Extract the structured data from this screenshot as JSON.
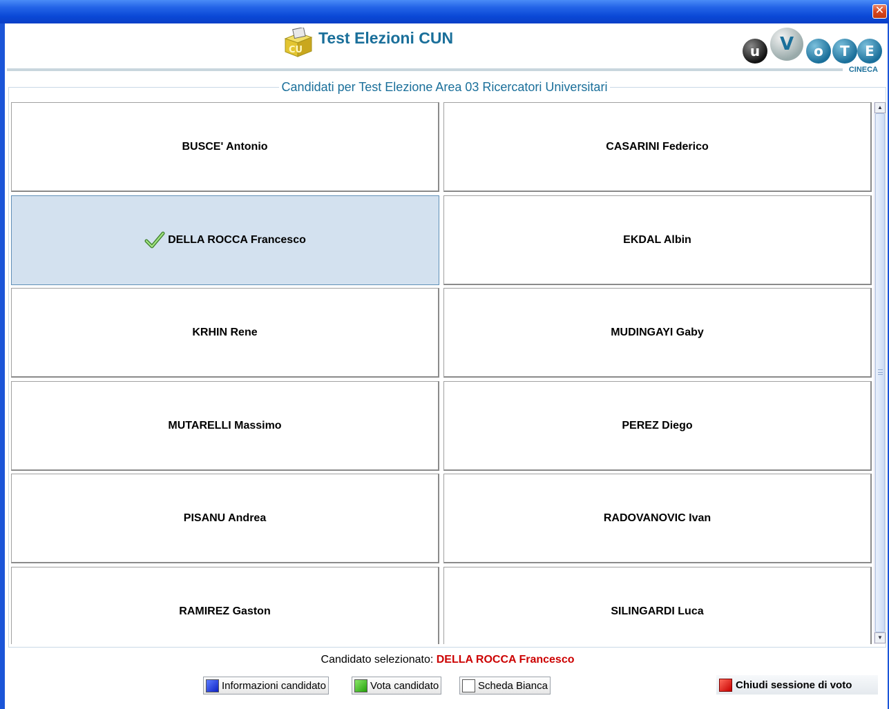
{
  "window": {
    "close_glyph": "✕"
  },
  "header": {
    "title": "Test Elezioni CUN",
    "brand_letters": [
      "u",
      "V",
      "o",
      "T",
      "E"
    ],
    "brand_sub": "CINECA",
    "colors": {
      "title": "#1a6f9a",
      "brand_dark": "#222222",
      "brand_blue": "#1a6f9a"
    }
  },
  "panel": {
    "title": "Candidati per Test Elezione Area 03 Ricercatori Universitari"
  },
  "candidates": [
    {
      "name": "BUSCE' Antonio",
      "selected": false
    },
    {
      "name": "CASARINI Federico",
      "selected": false
    },
    {
      "name": "DELLA ROCCA Francesco",
      "selected": true
    },
    {
      "name": "EKDAL Albin",
      "selected": false
    },
    {
      "name": "KRHIN Rene",
      "selected": false
    },
    {
      "name": "MUDINGAYI Gaby",
      "selected": false
    },
    {
      "name": "MUTARELLI Massimo",
      "selected": false
    },
    {
      "name": "PEREZ Diego",
      "selected": false
    },
    {
      "name": "PISANU Andrea",
      "selected": false
    },
    {
      "name": "RADOVANOVIC Ivan",
      "selected": false
    },
    {
      "name": "RAMIREZ Gaston",
      "selected": false
    },
    {
      "name": "SILINGARDI Luca",
      "selected": false
    }
  ],
  "status": {
    "label": "Candidato selezionato:",
    "selected_name": "DELLA ROCCA Francesco"
  },
  "buttons": {
    "info": "Informazioni candidato",
    "vote": "Vota candidato",
    "blank": "Scheda Bianca",
    "close_session": "Chiudi sessione di voto",
    "colors": {
      "info": "#1530e0",
      "vote": "#3cbc1c",
      "blank": "#ffffff",
      "close_session": "#e01010"
    }
  }
}
